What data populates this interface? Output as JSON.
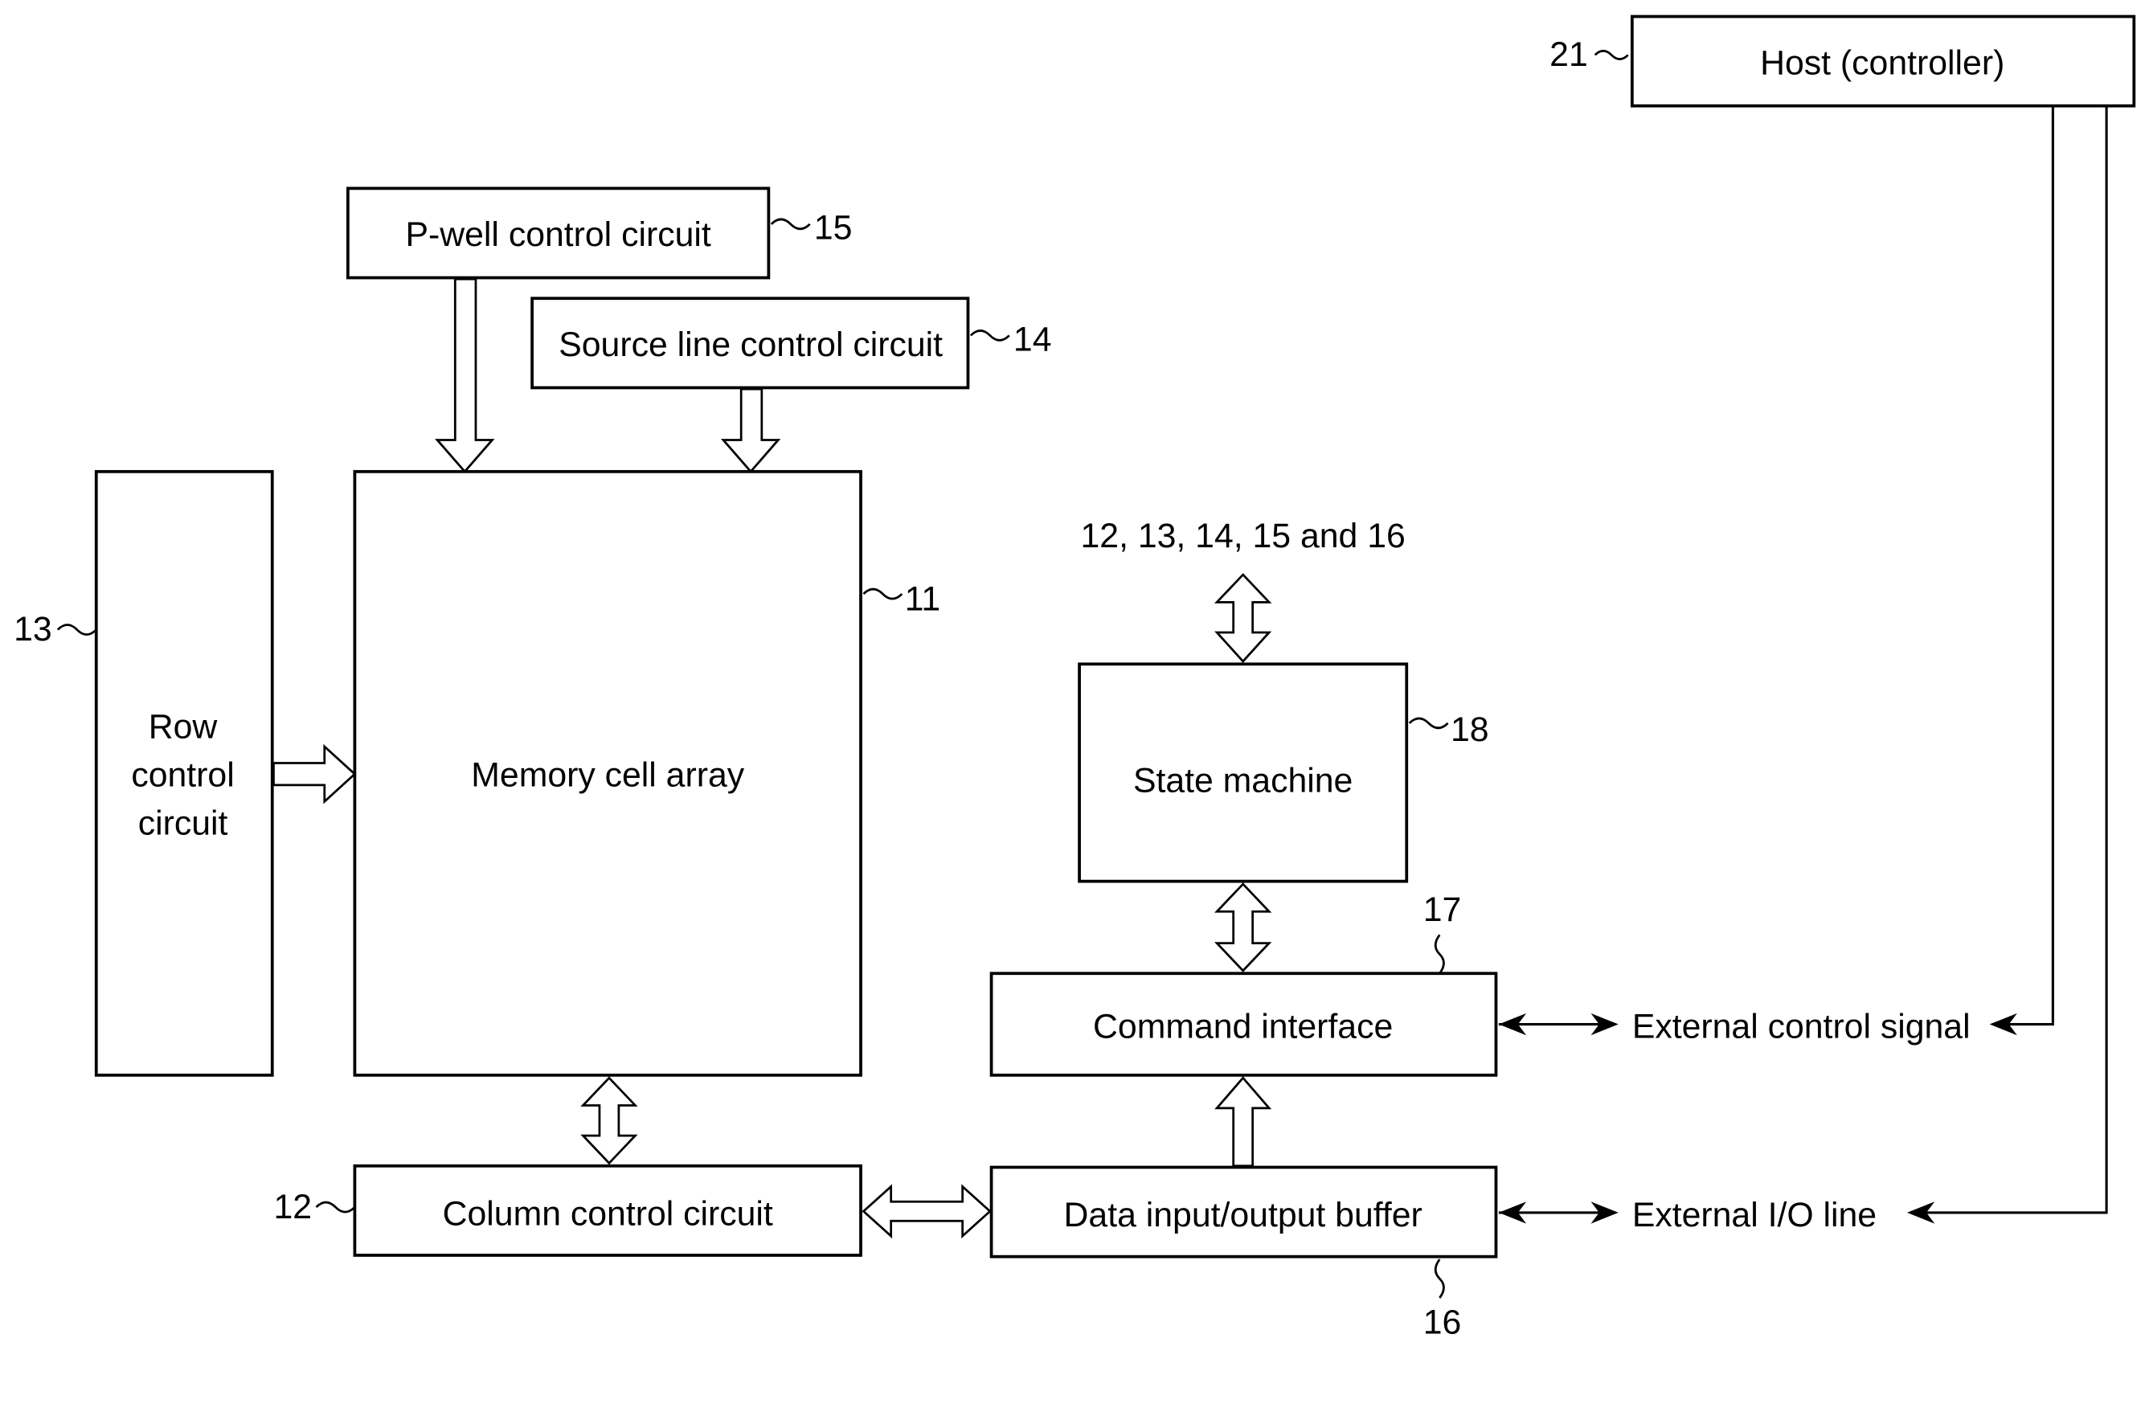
{
  "figure": {
    "type": "block-diagram",
    "blocks": {
      "memory_cell_array": {
        "label": "Memory cell array",
        "ref": "11"
      },
      "column_control": {
        "label": "Column control circuit",
        "ref": "12"
      },
      "row_control": {
        "label_lines": [
          "Row",
          "control",
          "circuit"
        ],
        "ref": "13"
      },
      "source_line_control": {
        "label": "Source line control circuit",
        "ref": "14"
      },
      "pwell_control": {
        "label": "P-well control circuit",
        "ref": "15"
      },
      "data_io_buffer": {
        "label": "Data input/output buffer",
        "ref": "16"
      },
      "command_interface": {
        "label": "Command interface",
        "ref": "17"
      },
      "state_machine": {
        "label": "State machine",
        "ref": "18"
      },
      "host": {
        "label": "Host (controller)",
        "ref": "21"
      }
    },
    "annotations": {
      "state_machine_targets": "12, 13, 14, 15 and 16",
      "external_control_signal": "External control signal",
      "external_io_line": "External I/O line"
    },
    "connections": [
      {
        "from": "pwell_control",
        "to": "memory_cell_array",
        "kind": "bus",
        "direction": "one-way"
      },
      {
        "from": "source_line_control",
        "to": "memory_cell_array",
        "kind": "bus",
        "direction": "one-way"
      },
      {
        "from": "row_control",
        "to": "memory_cell_array",
        "kind": "bus",
        "direction": "one-way"
      },
      {
        "from": "memory_cell_array",
        "to": "column_control",
        "kind": "bus",
        "direction": "two-way"
      },
      {
        "from": "column_control",
        "to": "data_io_buffer",
        "kind": "bus",
        "direction": "two-way"
      },
      {
        "from": "data_io_buffer",
        "to": "command_interface",
        "kind": "bus",
        "direction": "one-way"
      },
      {
        "from": "command_interface",
        "to": "state_machine",
        "kind": "bus",
        "direction": "two-way"
      },
      {
        "from": "state_machine",
        "to": "12, 13, 14, 15 and 16",
        "kind": "bus",
        "direction": "two-way"
      },
      {
        "from": "command_interface",
        "to": "external_control_signal",
        "kind": "line",
        "direction": "two-way"
      },
      {
        "from": "data_io_buffer",
        "to": "external_io_line",
        "kind": "line",
        "direction": "two-way"
      },
      {
        "from": "host",
        "to": "external_control_signal",
        "kind": "line",
        "direction": "one-way"
      },
      {
        "from": "host",
        "to": "external_io_line",
        "kind": "line",
        "direction": "one-way"
      }
    ]
  }
}
